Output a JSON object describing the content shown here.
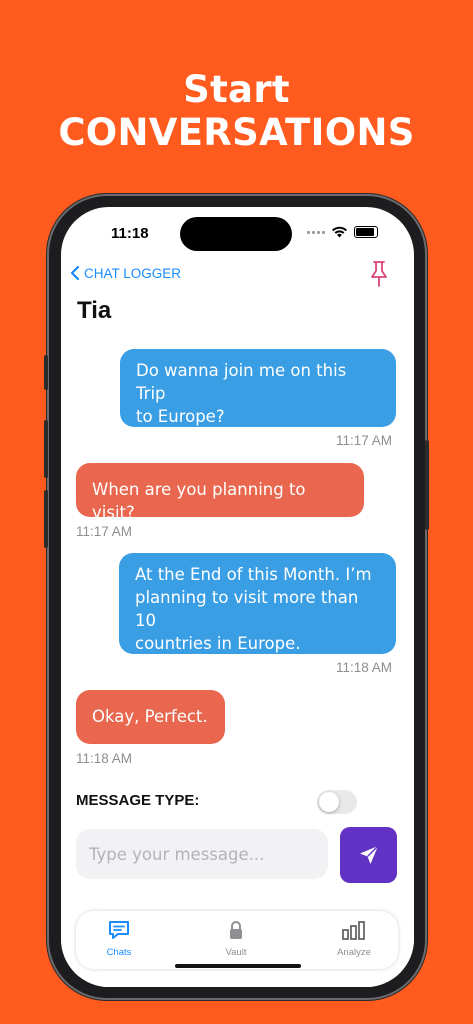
{
  "headline": "Start CONVERSATIONS",
  "status_bar": {
    "time": "11:18"
  },
  "nav": {
    "back_label": "CHAT LOGGER"
  },
  "chat": {
    "title": "Tia",
    "messages": [
      {
        "direction": "outgoing",
        "lines": [
          "Do wanna join me on this Trip",
          "to Europe?"
        ],
        "time": "11:17 AM"
      },
      {
        "direction": "incoming",
        "lines": [
          "When are you planning to visit?"
        ],
        "time": "11:17 AM"
      },
      {
        "direction": "outgoing",
        "lines": [
          "At the End of this Month. I’m",
          "planning to visit more than 10",
          "countries in Europe."
        ],
        "time": "11:18 AM"
      },
      {
        "direction": "incoming",
        "lines": [
          "Okay, Perfect."
        ],
        "time": "11:18 AM"
      }
    ]
  },
  "composer": {
    "message_type_label": "MESSAGE TYPE:",
    "placeholder": "Type your message...",
    "toggle_on": false
  },
  "tabs": [
    {
      "label": "Chats",
      "icon": "chat-bubble-icon",
      "active": true
    },
    {
      "label": "Vault",
      "icon": "lock-icon",
      "active": false
    },
    {
      "label": "Analyze",
      "icon": "bar-chart-icon",
      "active": false
    }
  ],
  "colors": {
    "background": "#FF5B1F",
    "outgoing_bubble": "#3a9ee4",
    "incoming_bubble": "#e8674e",
    "send_button": "#6132c4",
    "accent": "#1a8cff"
  }
}
